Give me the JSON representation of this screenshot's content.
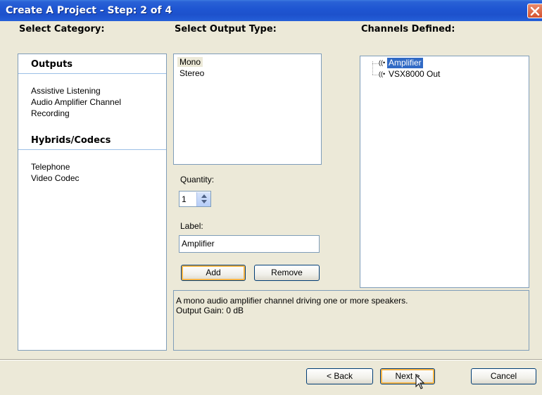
{
  "window": {
    "title": "Create A Project - Step: 2 of 4"
  },
  "headings": {
    "category": "Select Category:",
    "output_type": "Select Output Type:",
    "channels": "Channels Defined:"
  },
  "categories": [
    {
      "group": "Outputs",
      "items": [
        "Assistive Listening",
        "Audio Amplifier Channel",
        "Recording"
      ]
    },
    {
      "group": "Hybrids/Codecs",
      "items": [
        "Telephone",
        "Video Codec"
      ]
    }
  ],
  "output_types": {
    "items": [
      "Mono",
      "Stereo"
    ],
    "selected": "Mono"
  },
  "quantity": {
    "label": "Quantity:",
    "value": "1"
  },
  "channel_label": {
    "label": "Label:",
    "value": "Amplifier"
  },
  "actions": {
    "add": "Add",
    "remove": "Remove"
  },
  "channels_defined": {
    "items": [
      "Amplifier",
      "VSX8000 Out"
    ],
    "selected": "Amplifier",
    "icon": "speaker-channel-icon",
    "glyph": "((•"
  },
  "description": {
    "line1": "A mono audio amplifier channel driving one or more speakers.",
    "line2": "Output Gain: 0 dB"
  },
  "footer": {
    "back": "< Back",
    "next": "Next >",
    "cancel": "Cancel"
  },
  "colors": {
    "titlebar": "#1f56d2",
    "selection": "#316ac5",
    "dialog_bg": "#ece9d8",
    "focus_ring": "#f8b648"
  }
}
